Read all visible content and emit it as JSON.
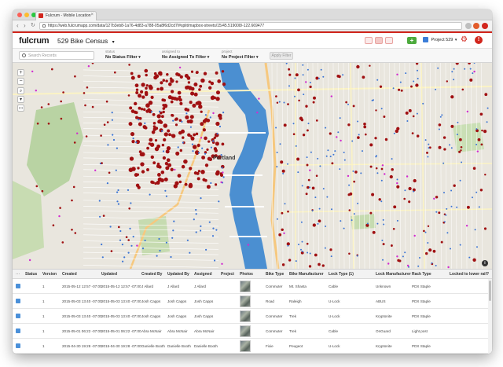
{
  "browser": {
    "tab_title": "Fulcrum - Mobile Location",
    "url": "https://web.fulcrumapp.com/data/127b3eb8-1a76-4d83-a788-05a8f6d2cd7f#split/mapbox-streets/15/45.519008/-122.669477",
    "colors": {
      "close": "#fc5f57",
      "minimize": "#fdbc2e",
      "maximize": "#28c840",
      "brand": "#d2261d"
    }
  },
  "app": {
    "logo": "fulcrum",
    "title": "529 Bike Census",
    "title_caret": "▾",
    "add_label": "+",
    "project_label": "Project 529",
    "project_caret": "▾",
    "gear_glyph": "⚙",
    "alert_glyph": "!"
  },
  "filters": {
    "search_placeholder": "Search Records",
    "status_caption": "status",
    "status_value": "No Status Filter",
    "assigned_caption": "assigned to",
    "assigned_value": "No Assigned To Filter",
    "project_caption": "project",
    "project_value": "No Project Filter",
    "apply_label": "Apply Filter"
  },
  "map": {
    "city_label": "Portland",
    "controls": [
      "+",
      "−",
      "⌕",
      "▾",
      "▭"
    ],
    "info_glyph": "i",
    "marker_colors": {
      "red": "#a01012",
      "blue": "#3b74d4",
      "magenta": "#d22ad0"
    }
  },
  "table": {
    "columns": [
      "Status",
      "Version",
      "Created",
      "Updated",
      "Created By",
      "Updated By",
      "Assigned",
      "Project",
      "Photos",
      "Bike Type",
      "Bike Manufacturer",
      "Lock Type (1)",
      "Lock Manufacturer",
      "Rack Type",
      "Locked to lower rail?"
    ],
    "rows": [
      {
        "version": "1",
        "created": "2015-05-12 12:57 -07:00",
        "updated": "2015-05-12 12:57 -07:00",
        "created_by": "J Allard",
        "updated_by": "J Allard",
        "assigned": "J Allard",
        "bike_type": "Commuter",
        "bike_mfr": "Mt. Shasta",
        "lock_type": "Cable",
        "lock_mfr": "Unknown",
        "rack_type": "PDX Staple"
      },
      {
        "version": "1",
        "created": "2015-05-03 13:40 -07:00",
        "updated": "2015-05-03 13:40 -07:00",
        "created_by": "Josh Capps",
        "updated_by": "Josh Capps",
        "assigned": "Josh Capps",
        "bike_type": "Road",
        "bike_mfr": "Raleigh",
        "lock_type": "U-Lock",
        "lock_mfr": "ABUS",
        "rack_type": "PDX Staple"
      },
      {
        "version": "1",
        "created": "2015-05-03 13:40 -07:00",
        "updated": "2015-05-03 13:40 -07:00",
        "created_by": "Josh Capps",
        "updated_by": "Josh Capps",
        "assigned": "Josh Capps",
        "bike_type": "Commuter",
        "bike_mfr": "Trek",
        "lock_type": "U-Lock",
        "lock_mfr": "Kryptonite",
        "rack_type": "PDX Staple"
      },
      {
        "version": "1",
        "created": "2015-05-01 06:22 -07:00",
        "updated": "2015-05-01 06:22 -07:00",
        "created_by": "Abra McNair",
        "updated_by": "Abra McNair",
        "assigned": "Abra McNair",
        "bike_type": "Commuter",
        "bike_mfr": "Trek",
        "lock_type": "Cable",
        "lock_mfr": "OnGuard",
        "rack_type": "Light post"
      },
      {
        "version": "1",
        "created": "2015-04-30 19:28 -07:00",
        "updated": "2015-04-30 19:28 -07:00",
        "created_by": "Danielle Booth",
        "updated_by": "Danielle Booth",
        "assigned": "Danielle Booth",
        "bike_type": "Fixie",
        "bike_mfr": "Peugeot",
        "lock_type": "U-Lock",
        "lock_mfr": "Kryptonite",
        "rack_type": "PDX Staple"
      }
    ]
  }
}
